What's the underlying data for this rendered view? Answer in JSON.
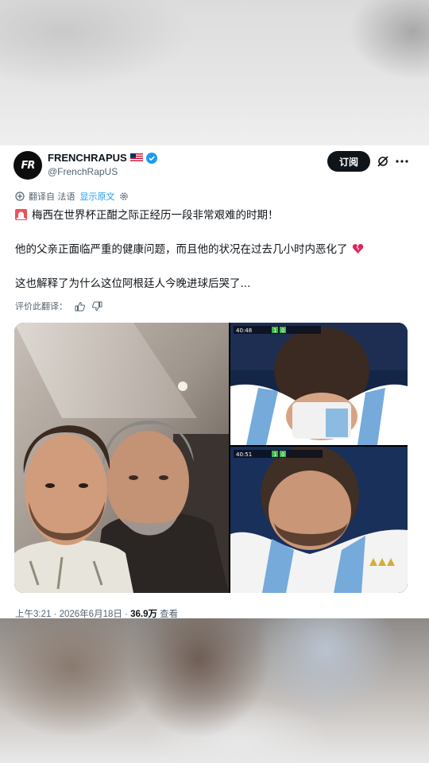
{
  "author": {
    "avatar_text": "FR",
    "display_name": "FRENCHRAPUS",
    "handle": "@FrenchRapUS",
    "flag": "us-flag-icon",
    "verified": "verified-badge-icon"
  },
  "actions": {
    "subscribe_label": "订阅"
  },
  "translation": {
    "translated_from": "翻译自 法语",
    "show_original": "显示原文"
  },
  "post": {
    "line1": "梅西在世界杯正酣之际正经历一段非常艰难的时期！",
    "line2": "他的父亲正面临严重的健康问题，而且他的状况在过去几小时内恶化了",
    "line3": "这也解释了为什么这位阿根廷人今晚进球后哭了..."
  },
  "rating": {
    "label": "评价此翻译："
  },
  "media": {
    "scoreboard_top": [
      "1",
      "0"
    ],
    "scoreboard_bottom": [
      "1",
      "0"
    ],
    "time_top": "40:48",
    "time_bottom": "40:51"
  },
  "meta": {
    "time_date": "上午3:21 · 2026年6月18日 · ",
    "views_count": "36.9万",
    "views_label": " 查看"
  },
  "colors": {
    "accent": "#1d9bf0",
    "text": "#0f1419",
    "muted": "#536471"
  }
}
